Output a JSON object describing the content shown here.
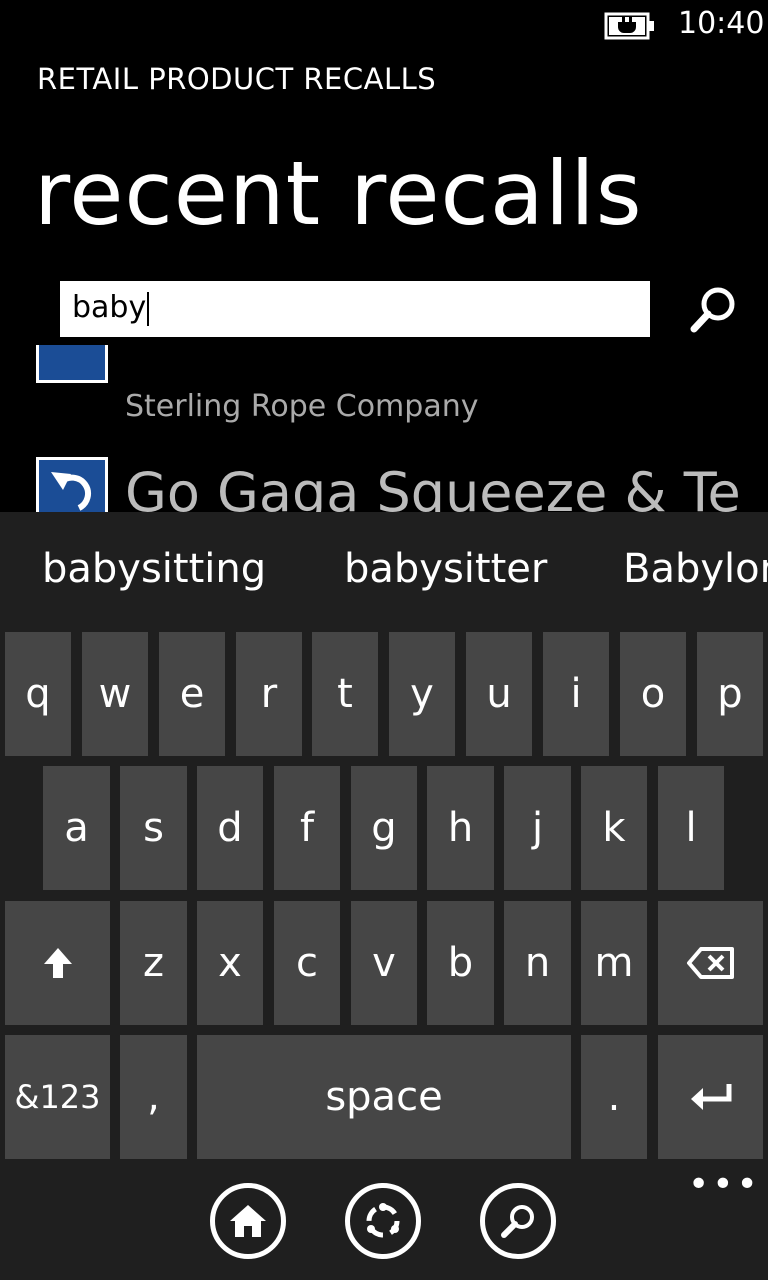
{
  "status": {
    "time": "10:40",
    "battery_icon": "battery-charging-icon"
  },
  "app": {
    "title": "RETAIL PRODUCT RECALLS",
    "page_title": "recent recalls"
  },
  "search": {
    "value": "baby",
    "button_icon": "search-icon"
  },
  "recalls": [
    {
      "company": "Sterling Rope Company",
      "icon": "recall-thumbnail-icon"
    },
    {
      "title": "Go Gaga Squeeze & Te",
      "icon": "undo-arrow-icon"
    }
  ],
  "keyboard": {
    "suggestions": [
      "babysitting",
      "babysitter",
      "Babylon"
    ],
    "row1": [
      "q",
      "w",
      "e",
      "r",
      "t",
      "y",
      "u",
      "i",
      "o",
      "p"
    ],
    "row2": [
      "a",
      "s",
      "d",
      "f",
      "g",
      "h",
      "j",
      "k",
      "l"
    ],
    "row3": [
      "z",
      "x",
      "c",
      "v",
      "b",
      "n",
      "m"
    ],
    "symbols_label": "&123",
    "comma_label": ",",
    "space_label": "space",
    "period_label": ".",
    "shift_icon": "shift-arrow-icon",
    "backspace_icon": "backspace-icon",
    "enter_icon": "enter-icon"
  },
  "nav": {
    "home_icon": "home-icon",
    "cortana_icon": "app-switch-icon",
    "search_icon": "search-icon",
    "more": "•••"
  }
}
